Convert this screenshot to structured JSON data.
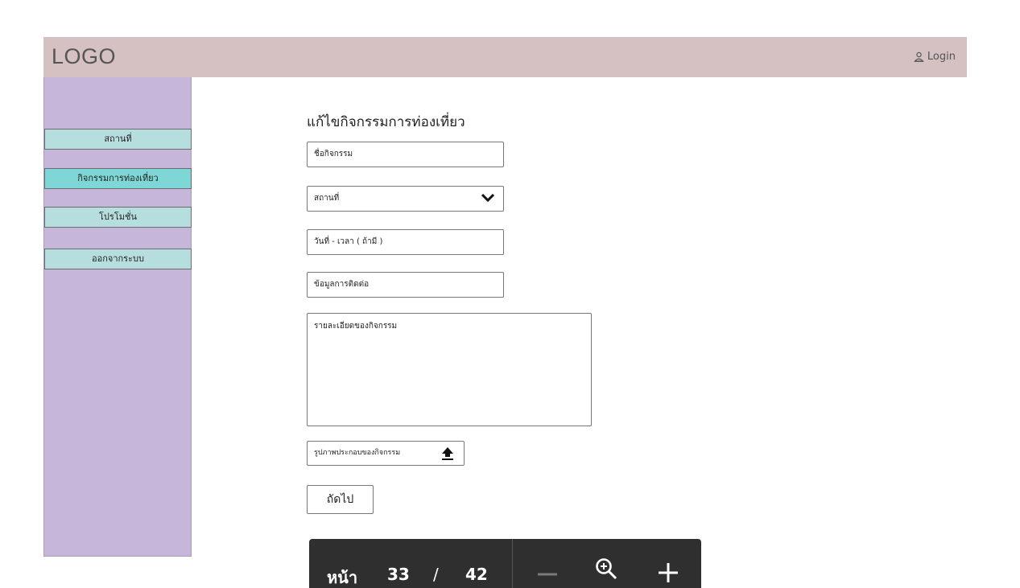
{
  "header": {
    "logo": "LOGO",
    "login_label": "Login"
  },
  "sidebar": {
    "items": [
      {
        "label": "สถานที่",
        "active": false
      },
      {
        "label": "กิจกรรมการท่องเที่ยว",
        "active": true
      },
      {
        "label": "โปรโมชั่น",
        "active": false
      },
      {
        "label": "ออกจากระบบ",
        "active": false
      }
    ]
  },
  "form": {
    "title": "แก้ไขกิจกรรมการท่องเที่ยว",
    "activity_name": "ชื่อกิจกรรม",
    "location_select": "สถานที่",
    "datetime": "วันที่ - เวลา ( ถ้ามี )",
    "contact": "ข้อมูลการติดต่อ",
    "details": "รายละเอียดของกิจกรรม",
    "image_upload": "รูปภาพประกอบของกิจกรรม",
    "next_label": "ถัดไป"
  },
  "pager": {
    "page_label": "หน้า",
    "current_page": "33",
    "separator": "/",
    "total_pages": "42"
  },
  "icons": {
    "user": "user-icon",
    "chevron": "chevron-down-icon",
    "upload": "upload-icon",
    "zoom_out": "minus-icon",
    "zoom": "zoom-in-icon",
    "zoom_in": "plus-icon"
  },
  "colors": {
    "header_bg": "#d5c1c2",
    "sidebar_bg": "#c6b6da",
    "sidebar_button_bg": "#b7dede",
    "sidebar_button_active_bg": "#7fd6d6",
    "pager_bg": "#2f2f2f"
  }
}
